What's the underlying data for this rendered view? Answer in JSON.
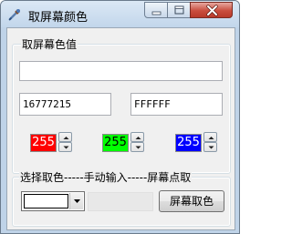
{
  "window": {
    "title": "取屏幕颜色",
    "icon": "eyedropper-icon",
    "controls": [
      "minimize-icon",
      "maximize-icon",
      "close-icon"
    ]
  },
  "main_group": {
    "label": "取屏幕色值",
    "color_value_field": "",
    "decimal_value": "16777215",
    "hex_value": "FFFFFF"
  },
  "rgb": {
    "red": "255",
    "green": "255",
    "blue": "255",
    "red_color": "#ff0000",
    "green_color": "#00ff00",
    "blue_color": "#0000ff"
  },
  "bottom_group": {
    "label": "选择取色-----手动输入-----屏幕点取",
    "selected_color": "#ffffff",
    "manual_input_value": "",
    "pick_button_label": "屏幕取色"
  }
}
